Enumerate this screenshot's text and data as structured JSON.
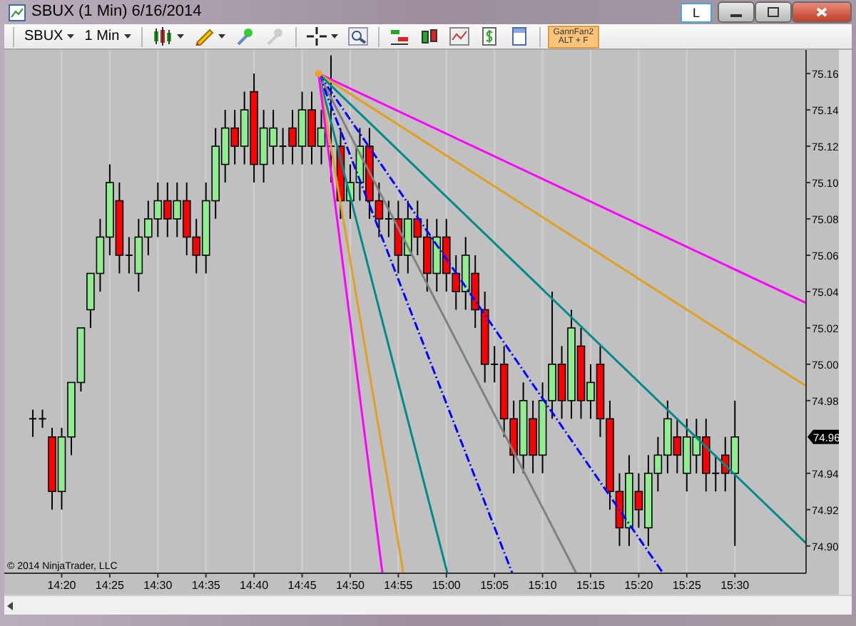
{
  "window": {
    "title": "SBUX (1 Min)  6/16/2014",
    "title_button": "L"
  },
  "toolbar": {
    "dropdowns": [
      {
        "label": "SBUX"
      },
      {
        "label": "1 Min"
      }
    ],
    "drawing_tool": {
      "label": "GannFan2",
      "shortcut": "ALT + F"
    }
  },
  "chart": {
    "copyright": "© 2014 NinjaTrader, LLC",
    "last_price": "74.96",
    "chart_data": {
      "type": "candlestick",
      "x": [
        857,
        858,
        859,
        860,
        861,
        862,
        863,
        864,
        865,
        866,
        867,
        868,
        869,
        870,
        871,
        872,
        873,
        874,
        875,
        876,
        877,
        878,
        879,
        880,
        881,
        882,
        883,
        884,
        885,
        886,
        887,
        888,
        889,
        890,
        891,
        892,
        893,
        894,
        895,
        896,
        897,
        898,
        899,
        900,
        901,
        902,
        903,
        904,
        905,
        906,
        907,
        908,
        909,
        910,
        911,
        912,
        913,
        914,
        915,
        916,
        917,
        918,
        919,
        920,
        921,
        922,
        923,
        924,
        925,
        926,
        927,
        928,
        929,
        930
      ],
      "xlim": [
        854.03,
        937.4
      ],
      "grid": true,
      "xticks": [
        {
          "value": 860,
          "label": "14:20"
        },
        {
          "value": 865,
          "label": "14:25"
        },
        {
          "value": 870,
          "label": "14:30"
        },
        {
          "value": 875,
          "label": "14:35"
        },
        {
          "value": 880,
          "label": "14:40"
        },
        {
          "value": 885,
          "label": "14:45"
        },
        {
          "value": 890,
          "label": "14:50"
        },
        {
          "value": 895,
          "label": "14:55"
        },
        {
          "value": 900,
          "label": "15:00"
        },
        {
          "value": 905,
          "label": "15:05"
        },
        {
          "value": 910,
          "label": "15:10"
        },
        {
          "value": 915,
          "label": "15:15"
        },
        {
          "value": 920,
          "label": "15:20"
        },
        {
          "value": 925,
          "label": "15:25"
        },
        {
          "value": 930,
          "label": "15:30"
        }
      ],
      "ohlc": [
        [
          74.97,
          74.975,
          74.96,
          74.97
        ],
        [
          74.97,
          74.975,
          74.965,
          74.97
        ],
        [
          74.96,
          74.965,
          74.92,
          74.93
        ],
        [
          74.93,
          74.965,
          74.92,
          74.96
        ],
        [
          74.96,
          74.99,
          74.95,
          74.99
        ],
        [
          74.99,
          75.02,
          74.985,
          75.02
        ],
        [
          75.03,
          75.05,
          75.02,
          75.05
        ],
        [
          75.05,
          75.08,
          75.04,
          75.07
        ],
        [
          75.07,
          75.11,
          75.06,
          75.1
        ],
        [
          75.09,
          75.1,
          75.05,
          75.06
        ],
        [
          75.06,
          75.07,
          75.05,
          75.06
        ],
        [
          75.05,
          75.08,
          75.04,
          75.07
        ],
        [
          75.07,
          75.09,
          75.06,
          75.08
        ],
        [
          75.08,
          75.1,
          75.07,
          75.09
        ],
        [
          75.09,
          75.1,
          75.07,
          75.08
        ],
        [
          75.08,
          75.1,
          75.07,
          75.09
        ],
        [
          75.09,
          75.1,
          75.06,
          75.07
        ],
        [
          75.07,
          75.08,
          75.05,
          75.06
        ],
        [
          75.06,
          75.1,
          75.05,
          75.09
        ],
        [
          75.09,
          75.13,
          75.08,
          75.12
        ],
        [
          75.11,
          75.14,
          75.1,
          75.13
        ],
        [
          75.13,
          75.14,
          75.11,
          75.12
        ],
        [
          75.12,
          75.15,
          75.11,
          75.14
        ],
        [
          75.15,
          75.16,
          75.1,
          75.11
        ],
        [
          75.11,
          75.14,
          75.1,
          75.13
        ],
        [
          75.12,
          75.14,
          75.11,
          75.13
        ],
        [
          75.12,
          75.13,
          75.11,
          75.12
        ],
        [
          75.13,
          75.14,
          75.11,
          75.12
        ],
        [
          75.12,
          75.15,
          75.11,
          75.14
        ],
        [
          75.14,
          75.15,
          75.11,
          75.12
        ],
        [
          75.12,
          75.14,
          75.11,
          75.13
        ],
        [
          75.12,
          75.17,
          75.1,
          75.12
        ],
        [
          75.12,
          75.13,
          75.08,
          75.09
        ],
        [
          75.09,
          75.11,
          75.08,
          75.1
        ],
        [
          75.1,
          75.13,
          75.09,
          75.12
        ],
        [
          75.12,
          75.13,
          75.08,
          75.09
        ],
        [
          75.09,
          75.1,
          75.07,
          75.08
        ],
        [
          75.08,
          75.09,
          75.07,
          75.08
        ],
        [
          75.08,
          75.09,
          75.05,
          75.06
        ],
        [
          75.06,
          75.09,
          75.05,
          75.08
        ],
        [
          75.08,
          75.09,
          75.06,
          75.07
        ],
        [
          75.07,
          75.08,
          75.04,
          75.05
        ],
        [
          75.05,
          75.08,
          75.04,
          75.07
        ],
        [
          75.07,
          75.08,
          75.04,
          75.05
        ],
        [
          75.05,
          75.06,
          75.03,
          75.04
        ],
        [
          75.04,
          75.07,
          75.03,
          75.06
        ],
        [
          75.05,
          75.06,
          75.02,
          75.03
        ],
        [
          75.03,
          75.04,
          74.99,
          75.0
        ],
        [
          75.0,
          75.01,
          74.99,
          75.0
        ],
        [
          75.0,
          75.01,
          74.96,
          74.97
        ],
        [
          74.97,
          74.98,
          74.94,
          74.95
        ],
        [
          74.95,
          74.99,
          74.94,
          74.98
        ],
        [
          74.97,
          74.98,
          74.94,
          74.95
        ],
        [
          74.95,
          74.99,
          74.94,
          74.98
        ],
        [
          74.98,
          75.04,
          74.97,
          75.0
        ],
        [
          75.0,
          75.01,
          74.97,
          74.98
        ],
        [
          74.98,
          75.03,
          74.97,
          75.02
        ],
        [
          75.01,
          75.02,
          74.97,
          74.98
        ],
        [
          74.98,
          75.0,
          74.97,
          74.99
        ],
        [
          75.0,
          75.01,
          74.96,
          74.97
        ],
        [
          74.97,
          74.98,
          74.92,
          74.93
        ],
        [
          74.93,
          74.94,
          74.9,
          74.91
        ],
        [
          74.91,
          74.95,
          74.9,
          74.94
        ],
        [
          74.93,
          74.94,
          74.91,
          74.92
        ],
        [
          74.91,
          74.95,
          74.9,
          74.94
        ],
        [
          74.94,
          74.96,
          74.93,
          74.95
        ],
        [
          74.95,
          74.98,
          74.94,
          74.97
        ],
        [
          74.96,
          74.97,
          74.94,
          74.95
        ],
        [
          74.94,
          74.97,
          74.93,
          74.96
        ],
        [
          74.95,
          74.97,
          74.94,
          74.96
        ],
        [
          74.96,
          74.97,
          74.93,
          74.94
        ],
        [
          74.94,
          74.95,
          74.93,
          74.94
        ],
        [
          74.95,
          74.96,
          74.93,
          74.94
        ],
        [
          74.94,
          74.98,
          74.9,
          74.96
        ]
      ],
      "ylim": [
        74.885,
        75.173
      ],
      "yticks": [
        {
          "value": 74.9,
          "label": "74.90"
        },
        74.92,
        74.94,
        74.98,
        {
          "value": 75.0,
          "label": "75.00"
        },
        75.02,
        75.04,
        75.06,
        75.08,
        {
          "value": 75.1,
          "label": "75.10"
        },
        75.12,
        75.14,
        75.16
      ]
    }
  }
}
